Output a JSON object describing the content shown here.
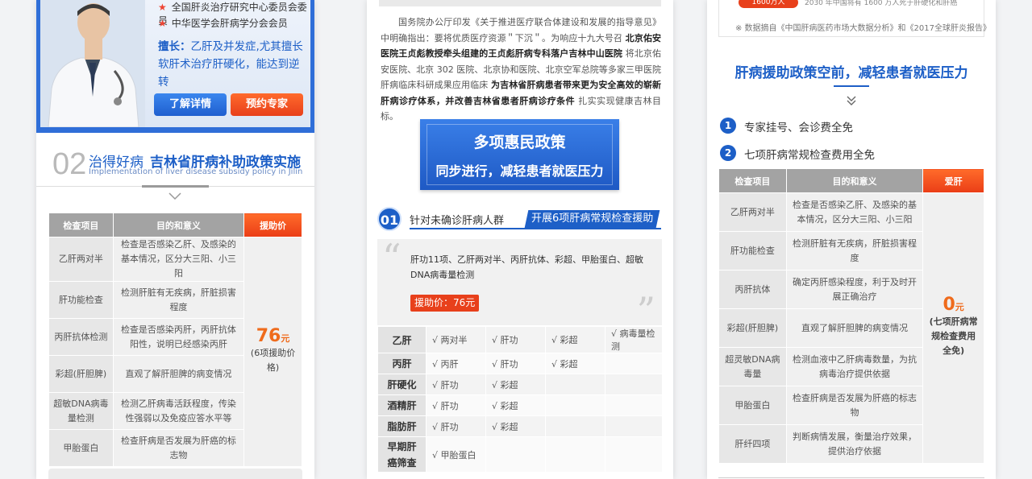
{
  "panel1": {
    "credentials": [
      "全国肝炎治疗研究中心委员会委员",
      "中华医学会肝病学分会会员"
    ],
    "specialty_label": "擅长：",
    "specialty_text": "乙肝及并发症,尤其擅长软肝术治疗肝硬化，能达到逆转",
    "btn_details": "了解详情",
    "btn_book": "预约专家",
    "section_num": "02",
    "section_title_a": "治得好病",
    "section_title_b": "吉林省肝病补助政策实施",
    "section_en": "Implementation of liver disease subsidy policy in Jilin",
    "table": {
      "headers": [
        "检查项目",
        "目的和意义",
        "援助价"
      ],
      "rows": [
        {
          "item": "乙肝两对半",
          "purpose": "检查是否感染乙肝、及感染的基本情况，区分大三阳、小三阳"
        },
        {
          "item": "肝功能检查",
          "purpose": "检测肝脏有无疾病，肝脏损害程度"
        },
        {
          "item": "丙肝抗体检测",
          "purpose": "检查是否感染丙肝，丙肝抗体阳性，说明已经感染丙肝"
        },
        {
          "item": "彩超(肝胆脾)",
          "purpose": "直观了解肝胆脾的病变情况"
        },
        {
          "item": "超敏DNA病毒量检测",
          "purpose": "检测乙肝病毒活跃程度，传染性强弱以及免疫应答水平等"
        },
        {
          "item": "甲胎蛋白",
          "purpose": "检查肝病是否发展为肝癌的标志物"
        }
      ],
      "price_value": "76",
      "price_unit": "元",
      "price_note": "(6项援助价格)"
    }
  },
  "panel2": {
    "para_1": "国务院办公厅印发《关于推进医疗联合体建设和发展的指导意见》中明确指出：要将优质医疗资源＂下沉＂。为响应十九大号召 ",
    "para_b1": "北京佑安医院王贞彪教授牵头组建的王贞彪肝病专科落户吉林中山医院",
    "para_2": " 将北京佑安医院、北京 302 医院、北京协和医院、北京空军总院等多家三甲医院肝病临床科研成果应用临床 ",
    "para_b2": "为吉林省肝病患者带来更为安全高效的崭新肝病诊疗体系，并改善吉林省患者肝病诊疗条件",
    "para_3": " 扎实实现健康吉林目标。",
    "banner_line1": "多项惠民政策",
    "banner_line2": "同步进行，减轻患者就医压力",
    "sub_num": "01",
    "sub_text": "针对未确诊肝病人群",
    "sub_tag": "开展6项肝病常规检查援助",
    "quote_text": "肝功11项、乙肝两对半、丙肝抗体、彩超、甲胎蛋白、超敏DNA病毒量检测",
    "quote_price": "援助价：76元",
    "grid_rows": [
      {
        "label": "乙肝",
        "cells": [
          "√ 两对半",
          "√ 肝功",
          "√ 彩超",
          "√ 病毒量检测"
        ]
      },
      {
        "label": "丙肝",
        "cells": [
          "√ 丙肝",
          "√ 肝功",
          "√ 彩超",
          ""
        ]
      },
      {
        "label": "肝硬化",
        "cells": [
          "√ 肝功",
          "√ 彩超",
          "",
          ""
        ]
      },
      {
        "label": "酒精肝",
        "cells": [
          "√ 肝功",
          "√ 彩超",
          "",
          ""
        ]
      },
      {
        "label": "脂肪肝",
        "cells": [
          "√ 肝功",
          "√ 彩超",
          "",
          ""
        ]
      },
      {
        "label": "早期肝癌筛查",
        "cells": [
          "√ 甲胎蛋白",
          "",
          "",
          ""
        ]
      }
    ]
  },
  "panel3": {
    "pill_text": "1600万人",
    "top_text": "2030 年中国将有 1600 万人死于肝硬化和肝癌",
    "source": "※  数据摘自《中国肝病医药市场大数据分析》和《2017全球肝炎报告》",
    "title": "肝病援助政策空前，减轻患者就医压力",
    "item1_num": "1",
    "item1": "专家挂号、会诊费全免",
    "item2_num": "2",
    "item2": "七项肝病常规检查费用全免",
    "table": {
      "headers": [
        "检查项目",
        "目的和意义",
        "爱肝"
      ],
      "rows": [
        {
          "item": "乙肝两对半",
          "purpose": "检查是否感染乙肝、及感染的基本情况，区分大三阳、小三阳"
        },
        {
          "item": "肝功能检查",
          "purpose": "检测肝脏有无疾病，肝脏损害程度"
        },
        {
          "item": "丙肝抗体",
          "purpose": "确定丙肝感染程度，利于及时开展正确治疗"
        },
        {
          "item": "彩超(肝胆脾)",
          "purpose": "直观了解肝胆脾的病变情况"
        },
        {
          "item": "超灵敏DNA病毒量",
          "purpose": "检测血液中乙肝病毒数量，为抗病毒治疗提供依据"
        },
        {
          "item": "甲胎蛋白",
          "purpose": "检查肝病是否发展为肝癌的标志物"
        },
        {
          "item": "肝纤四项",
          "purpose": "判断病情发展，衡量治疗效果，提供治疗依据"
        }
      ],
      "price_value": "0",
      "price_unit": "元",
      "price_note": "(七项肝病常规检查费用全免)"
    }
  },
  "colors": {
    "blue": "#1d5fc7",
    "orange": "#ef6b1c",
    "red": "#e8401b"
  }
}
